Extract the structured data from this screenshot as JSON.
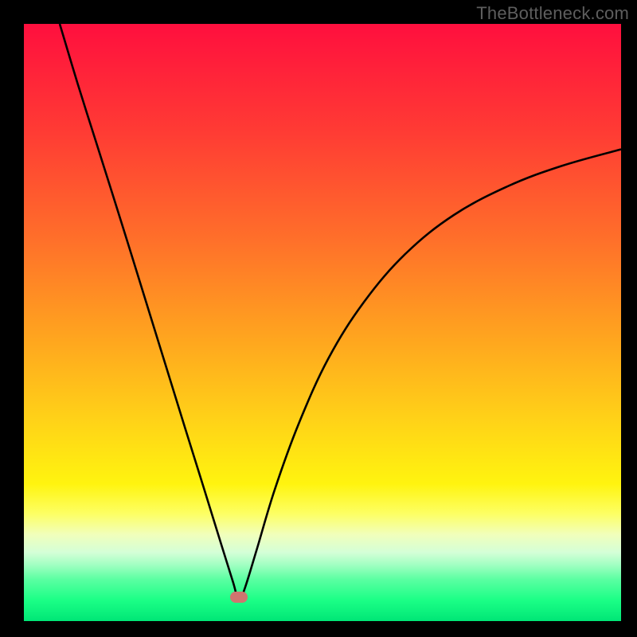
{
  "watermark": "TheBottleneck.com",
  "plot": {
    "inner_x": 30,
    "inner_y": 30,
    "inner_w": 750,
    "inner_h": 750
  },
  "chart_data": {
    "type": "line",
    "title": "",
    "xlabel": "",
    "ylabel": "",
    "x_range": [
      0,
      100
    ],
    "y_range": [
      0,
      100
    ],
    "background_gradient": {
      "stops": [
        {
          "pos": 0.0,
          "color": "#ff0f3e"
        },
        {
          "pos": 0.18,
          "color": "#ff3b34"
        },
        {
          "pos": 0.36,
          "color": "#ff6f2a"
        },
        {
          "pos": 0.52,
          "color": "#ffa31f"
        },
        {
          "pos": 0.66,
          "color": "#ffd118"
        },
        {
          "pos": 0.77,
          "color": "#fff40f"
        },
        {
          "pos": 0.82,
          "color": "#fdff63"
        },
        {
          "pos": 0.855,
          "color": "#f1ffbb"
        },
        {
          "pos": 0.885,
          "color": "#d4ffd7"
        },
        {
          "pos": 0.905,
          "color": "#a4ffc3"
        },
        {
          "pos": 0.93,
          "color": "#5bffa2"
        },
        {
          "pos": 0.965,
          "color": "#1bff86"
        },
        {
          "pos": 1.0,
          "color": "#00e676"
        }
      ]
    },
    "anchor": {
      "x": 36.0,
      "y": 4.0,
      "label": "optimal-point",
      "color": "#cf756f"
    },
    "series": [
      {
        "name": "bottleneck-curve",
        "color": "#000000",
        "width": 2.6,
        "x": [
          6,
          9,
          12,
          15,
          18,
          21,
          24,
          27,
          30,
          33,
          35,
          36,
          37,
          39,
          42,
          46,
          51,
          57,
          64,
          72,
          81,
          90,
          100
        ],
        "y": [
          100,
          90,
          80.5,
          71,
          61.4,
          51.7,
          42,
          32.3,
          22.7,
          13,
          6.6,
          3.5,
          5.5,
          12,
          22,
          33,
          44,
          53.5,
          61.6,
          68,
          72.8,
          76.2,
          79
        ]
      }
    ]
  }
}
